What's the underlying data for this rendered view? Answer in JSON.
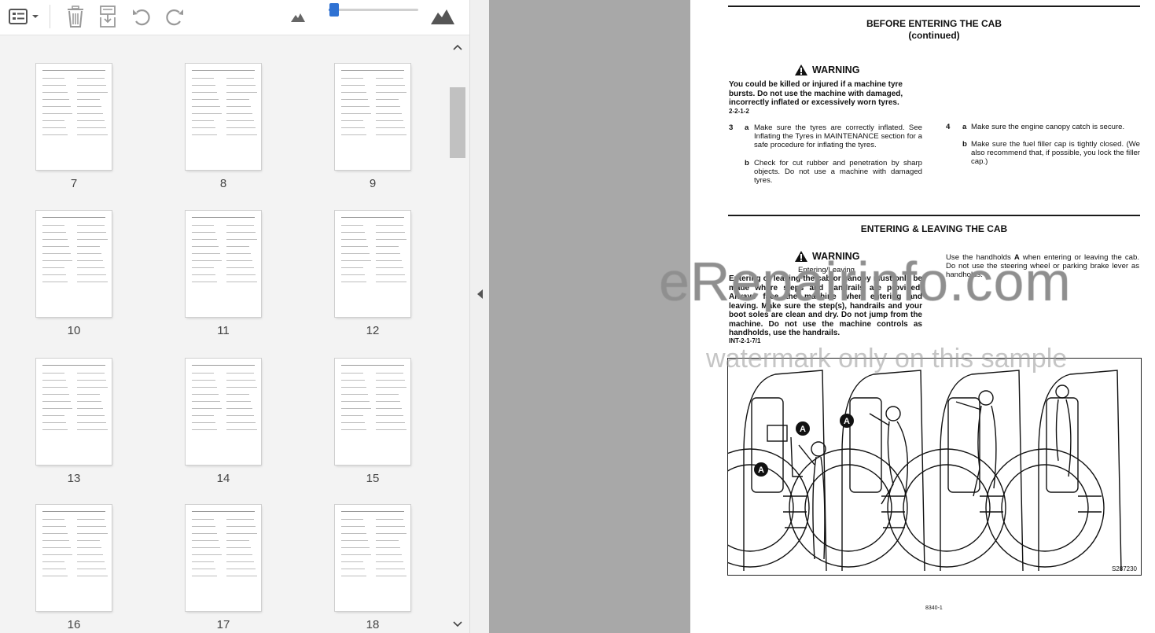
{
  "toolbar": {
    "buttons": [
      {
        "icon": "view-options-icon"
      },
      {
        "icon": "delete-icon"
      },
      {
        "icon": "extract-pages-icon"
      },
      {
        "icon": "rotate-left-icon"
      },
      {
        "icon": "rotate-right-icon"
      },
      {
        "icon": "small-mountain-icon"
      },
      {
        "icon": "large-mountain-icon"
      }
    ],
    "zoom_slider_level": 0.03
  },
  "thumbnails": {
    "pages": [
      "7",
      "8",
      "9",
      "10",
      "11",
      "12",
      "13",
      "14",
      "15",
      "16",
      "17",
      "18"
    ]
  },
  "document": {
    "section1_title_line1": "BEFORE ENTERING THE CAB",
    "section1_title_line2": "(continued)",
    "warning1_label": "WARNING",
    "warning1_text": "You could be killed or injured if a machine tyre bursts. Do not use the machine with damaged, incorrectly inflated or excessively worn tyres.",
    "warning1_code": "2-2-1-2",
    "step3_num": "3",
    "step3a_letter": "a",
    "step3a_text": "Make sure the tyres are correctly inflated. See Inflating the Tyres in MAINTENANCE section for a safe procedure for inflating the tyres.",
    "step3b_letter": "b",
    "step3b_text": "Check for cut rubber and penetration by sharp objects. Do not use a machine with damaged tyres.",
    "step4_num": "4",
    "step4a_letter": "a",
    "step4a_text": "Make sure the engine canopy catch is secure.",
    "step4b_letter": "b",
    "step4b_text": "Make sure the fuel filler cap is tightly closed. (We also recommend that, if possible, you lock the filler cap.)",
    "section2_title": "ENTERING & LEAVING THE CAB",
    "warning2_label": "WARNING",
    "warning2_subtitle": "Entering/Leaving",
    "warning2_text": "Entering or leaving the cab or canopy must only be made where steps and handrails are provided. Always face the machine when entering and leaving. Make sure the step(s), handrails and your boot soles are clean and dry. Do not jump from the machine. Do not use the machine controls as handholds, use the handrails.",
    "warning2_code": "INT-2-1-7/1",
    "handhold_text_pre": "Use the handholds ",
    "handhold_letter": "A",
    "handhold_text_post": " when entering or leaving the cab. Do not use the steering wheel or parking brake lever as handholds.",
    "figure_callout": "A",
    "figure_code": "S287230",
    "page_footer": "8340-1",
    "watermark_main": "eRepairinfo.com",
    "watermark_sub": "watermark only on this sample"
  }
}
